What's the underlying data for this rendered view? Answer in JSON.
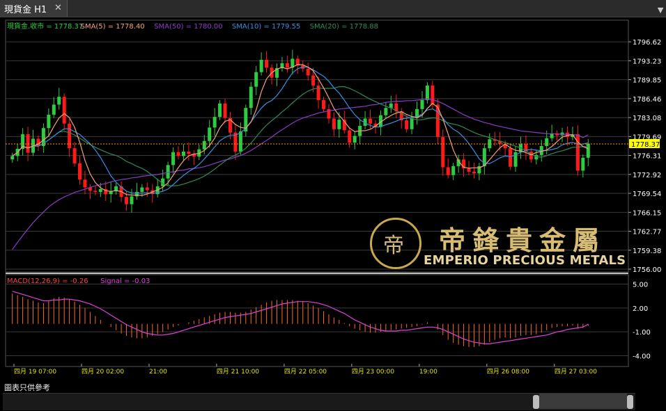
{
  "tab": {
    "title": "現貨金 H1",
    "close": "✕"
  },
  "legend": [
    {
      "text": "現貨金.收市 = 1778.37",
      "color": "#2ecc40"
    },
    {
      "text": "SMA(5) = 1778.40",
      "color": "#f4a37a"
    },
    {
      "text": "SMA(50) = 1780.00",
      "color": "#8a3cc8"
    },
    {
      "text": "SMA(10) = 1779.55",
      "color": "#3a8fe0"
    },
    {
      "text": "SMA(20) = 1778.88",
      "color": "#2e8b57"
    }
  ],
  "macd_legend": {
    "label": "MACD(12,26,9) = -0.26",
    "signal": "Signal = -0.03"
  },
  "price_axis": [
    "1796.62",
    "1793.23",
    "1789.85",
    "1786.46",
    "1783.08",
    "1779.69",
    "1776.31",
    "1772.92",
    "1769.54",
    "1766.15",
    "1762.77",
    "1759.38",
    "1756.00"
  ],
  "current_price": "1778.37",
  "macd_axis": [
    "5.00",
    "2.00",
    "-1.00",
    "-4.00"
  ],
  "time_labels": [
    "四月 19 07:00",
    "四月 20 02:00",
    "21:00",
    "四月 21 10:00",
    "四月 22 05:00",
    "四月 23 00:00",
    "19:00",
    "四月 26 08:00",
    "四月 27 03:00"
  ],
  "logo": {
    "cn": "帝鋒貴金屬",
    "en": "EMPERIO PRECIOUS METALS",
    "mark": "帝"
  },
  "disclaimer": "圖表只供參考",
  "colors": {
    "up": "#2ecc40",
    "down": "#ff1a1a",
    "grid": "#3a3a3a",
    "axis_text": "#ffffff",
    "macd_bar": "#ff6a1a",
    "signal": "#e040e0",
    "price_line": "#ff9900"
  },
  "chart_data": {
    "type": "candlestick",
    "ylim": [
      1756.0,
      1798.0
    ],
    "macd_ylim": [
      -5,
      6
    ],
    "closes": [
      1776.2,
      1777.5,
      1780.1,
      1776.8,
      1779.3,
      1778.0,
      1781.2,
      1783.6,
      1785.4,
      1786.8,
      1782.0,
      1777.6,
      1774.9,
      1772.0,
      1770.6,
      1770.0,
      1769.8,
      1770.3,
      1769.4,
      1769.9,
      1770.8,
      1768.9,
      1767.6,
      1769.0,
      1769.8,
      1770.6,
      1770.1,
      1769.4,
      1770.8,
      1772.2,
      1774.6,
      1776.9,
      1776.2,
      1777.0,
      1776.6,
      1776.1,
      1777.4,
      1778.9,
      1781.3,
      1783.2,
      1785.6,
      1783.0,
      1780.4,
      1777.0,
      1780.6,
      1784.8,
      1788.6,
      1791.2,
      1793.4,
      1792.0,
      1790.2,
      1791.9,
      1792.8,
      1792.0,
      1793.6,
      1792.4,
      1791.8,
      1790.6,
      1788.8,
      1786.2,
      1784.6,
      1782.9,
      1781.0,
      1782.7,
      1780.8,
      1778.6,
      1779.8,
      1781.6,
      1782.9,
      1782.0,
      1781.4,
      1783.5,
      1784.8,
      1785.6,
      1784.2,
      1782.6,
      1781.0,
      1783.0,
      1784.6,
      1786.2,
      1788.8,
      1785.4,
      1779.6,
      1774.2,
      1772.8,
      1774.4,
      1775.6,
      1774.0,
      1773.4,
      1773.1,
      1774.4,
      1777.6,
      1779.2,
      1778.9,
      1778.4,
      1777.6,
      1774.3,
      1776.9,
      1778.3,
      1777.0,
      1775.6,
      1776.4,
      1778.0,
      1779.4,
      1780.2,
      1779.9,
      1780.4,
      1779.6,
      1780.1,
      1773.6,
      1775.9,
      1778.4
    ],
    "sma50": [
      1759.5,
      1760.8,
      1762.0,
      1763.2,
      1764.3,
      1765.3,
      1766.2,
      1767.1,
      1767.8,
      1768.4,
      1768.9,
      1769.3,
      1769.7,
      1770.0,
      1770.3,
      1770.6,
      1770.9,
      1771.1,
      1771.3,
      1771.6,
      1771.8,
      1772.0,
      1772.1,
      1772.3,
      1772.4,
      1772.6,
      1772.7,
      1772.8,
      1772.9,
      1773.1,
      1773.3,
      1773.4,
      1773.6,
      1773.7,
      1773.9,
      1774.0,
      1774.1,
      1774.3,
      1774.6,
      1774.9,
      1775.2,
      1775.5,
      1775.7,
      1776.0,
      1776.3,
      1776.7,
      1777.2,
      1777.8,
      1778.4,
      1779.0,
      1779.6,
      1780.3,
      1780.9,
      1781.5,
      1782.1,
      1782.6,
      1783.0,
      1783.3,
      1783.6,
      1783.9,
      1784.1,
      1784.3,
      1784.4,
      1784.6,
      1784.7,
      1784.8,
      1784.9,
      1785.0,
      1785.1,
      1785.3,
      1785.4,
      1785.6,
      1785.8,
      1785.9,
      1786.0,
      1786.0,
      1786.1,
      1786.1,
      1786.2,
      1786.3,
      1786.4,
      1786.3,
      1786.0,
      1785.6,
      1785.1,
      1784.6,
      1784.1,
      1783.6,
      1783.2,
      1782.8,
      1782.5,
      1782.2,
      1782.0,
      1781.7,
      1781.5,
      1781.3,
      1781.1,
      1780.9,
      1780.7,
      1780.6,
      1780.5,
      1780.4,
      1780.3,
      1780.2,
      1780.2,
      1780.2,
      1780.1,
      1780.1,
      1780.0,
      1780.0,
      1779.5,
      1780.0
    ],
    "macd": [
      3.8,
      3.6,
      3.4,
      3.1,
      2.9,
      2.7,
      2.6,
      2.9,
      3.2,
      3.4,
      3.3,
      3.1,
      2.8,
      2.4,
      2.0,
      1.5,
      1.0,
      0.5,
      0.0,
      -0.4,
      -0.8,
      -1.2,
      -1.5,
      -1.7,
      -1.8,
      -1.8,
      -1.7,
      -1.5,
      -1.3,
      -1.0,
      -0.7,
      -0.4,
      -0.2,
      0.0,
      0.2,
      0.4,
      0.6,
      0.8,
      1.0,
      1.2,
      1.4,
      1.5,
      1.5,
      1.4,
      1.4,
      1.5,
      1.8,
      2.1,
      2.4,
      2.7,
      2.9,
      3.0,
      3.0,
      3.0,
      3.0,
      2.9,
      2.8,
      2.6,
      2.3,
      2.0,
      1.6,
      1.2,
      0.8,
      0.5,
      0.1,
      -0.3,
      -0.6,
      -0.8,
      -1.0,
      -1.1,
      -1.1,
      -1.0,
      -0.9,
      -0.8,
      -0.7,
      -0.6,
      -0.5,
      -0.4,
      -0.3,
      -0.1,
      0.2,
      0.0,
      -0.7,
      -1.4,
      -2.0,
      -2.4,
      -2.6,
      -2.8,
      -2.9,
      -2.9,
      -2.8,
      -2.6,
      -2.3,
      -2.0,
      -1.8,
      -1.7,
      -1.8,
      -1.7,
      -1.5,
      -1.4,
      -1.4,
      -1.3,
      -1.1,
      -0.8,
      -0.5,
      -0.4,
      -0.3,
      -0.3,
      -0.2,
      -0.6,
      -0.5,
      -0.26
    ],
    "signal": [
      4.1,
      3.9,
      3.7,
      3.5,
      3.3,
      3.1,
      2.9,
      2.9,
      3.0,
      3.0,
      3.1,
      3.1,
      3.0,
      2.9,
      2.7,
      2.5,
      2.2,
      1.9,
      1.5,
      1.1,
      0.7,
      0.3,
      -0.1,
      -0.4,
      -0.7,
      -1.0,
      -1.2,
      -1.3,
      -1.4,
      -1.4,
      -1.3,
      -1.2,
      -1.0,
      -0.8,
      -0.6,
      -0.4,
      -0.2,
      0.0,
      0.2,
      0.4,
      0.6,
      0.8,
      0.9,
      1.0,
      1.1,
      1.2,
      1.3,
      1.5,
      1.7,
      1.9,
      2.1,
      2.3,
      2.5,
      2.6,
      2.7,
      2.8,
      2.8,
      2.8,
      2.7,
      2.6,
      2.4,
      2.2,
      1.9,
      1.6,
      1.3,
      0.9,
      0.5,
      0.2,
      -0.1,
      -0.4,
      -0.6,
      -0.8,
      -0.9,
      -0.9,
      -0.9,
      -0.8,
      -0.8,
      -0.7,
      -0.6,
      -0.5,
      -0.4,
      -0.4,
      -0.5,
      -0.7,
      -1.0,
      -1.3,
      -1.6,
      -1.9,
      -2.1,
      -2.3,
      -2.4,
      -2.5,
      -2.5,
      -2.4,
      -2.3,
      -2.2,
      -2.1,
      -2.0,
      -1.9,
      -1.8,
      -1.7,
      -1.6,
      -1.5,
      -1.4,
      -1.2,
      -1.0,
      -0.9,
      -0.7,
      -0.6,
      -0.5,
      -0.4,
      -0.03
    ]
  }
}
